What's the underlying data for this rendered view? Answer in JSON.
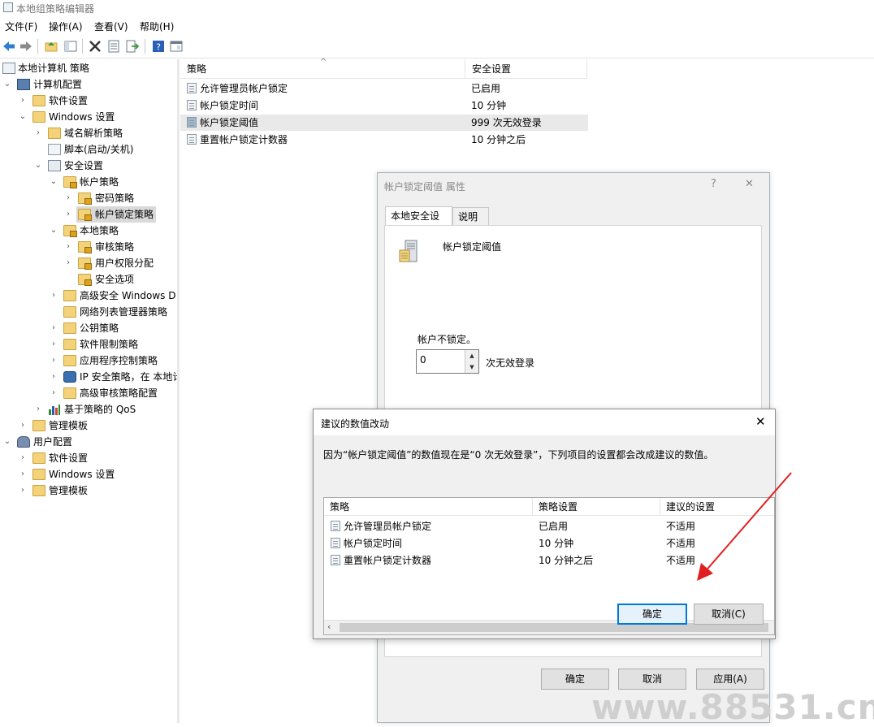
{
  "window": {
    "title": "本地组策略编辑器"
  },
  "menu": [
    "文件(F)",
    "操作(A)",
    "查看(V)",
    "帮助(H)"
  ],
  "toolbar": [
    "back-icon",
    "forward-icon",
    "up-folder-icon",
    "show-tree-icon",
    "delete-icon",
    "properties-icon",
    "export-icon",
    "help-icon",
    "console-icon"
  ],
  "tree": [
    {
      "label": "本地计算机 策略",
      "icon": "computer-policy-icon"
    },
    {
      "label": "计算机配置",
      "icon": "computer-icon"
    },
    {
      "label": "软件设置"
    },
    {
      "label": "Windows 设置"
    },
    {
      "label": "域名解析策略"
    },
    {
      "label": "脚本(启动/关机)"
    },
    {
      "label": "安全设置"
    },
    {
      "label": "帐户策略"
    },
    {
      "label": "密码策略"
    },
    {
      "label": "帐户锁定策略"
    },
    {
      "label": "本地策略"
    },
    {
      "label": "审核策略"
    },
    {
      "label": "用户权限分配"
    },
    {
      "label": "安全选项"
    },
    {
      "label": "高级安全 Windows D"
    },
    {
      "label": "网络列表管理器策略"
    },
    {
      "label": "公钥策略"
    },
    {
      "label": "软件限制策略"
    },
    {
      "label": "应用程序控制策略"
    },
    {
      "label": "IP 安全策略，在 本地计"
    },
    {
      "label": "高级审核策略配置"
    },
    {
      "label": "基于策略的 QoS"
    },
    {
      "label": "管理模板"
    },
    {
      "label": "用户配置"
    },
    {
      "label": "软件设置"
    },
    {
      "label": "Windows 设置"
    },
    {
      "label": "管理模板"
    }
  ],
  "list": {
    "headers": [
      "策略",
      "安全设置"
    ],
    "rows": [
      {
        "policy": "允许管理员帐户锁定",
        "setting": "已启用"
      },
      {
        "policy": "帐户锁定时间",
        "setting": "10 分钟"
      },
      {
        "policy": "帐户锁定阈值",
        "setting": "999 次无效登录"
      },
      {
        "policy": "重置帐户锁定计数器",
        "setting": "10 分钟之后"
      }
    ]
  },
  "props": {
    "title": "帐户锁定阈值 属性",
    "help": "?",
    "close": "✕",
    "tabs": [
      "本地安全设置",
      "说明"
    ],
    "policy_name": "帐户锁定阈值",
    "field_label": "帐户不锁定。",
    "value": "0",
    "unit": "次无效登录",
    "ok": "确定",
    "cancel": "取消",
    "apply": "应用(A)"
  },
  "suggest": {
    "title": "建议的数值改动",
    "close": "✕",
    "message": "因为“帐户锁定阈值”的数值现在是“0 次无效登录”，下列项目的设置都会改成建议的数值。",
    "headers": [
      "策略",
      "策略设置",
      "建议的设置"
    ],
    "rows": [
      {
        "policy": "允许管理员帐户锁定",
        "current": "已启用",
        "suggested": "不适用"
      },
      {
        "policy": "帐户锁定时间",
        "current": "10 分钟",
        "suggested": "不适用"
      },
      {
        "policy": "重置帐户锁定计数器",
        "current": "10 分钟之后",
        "suggested": "不适用"
      }
    ],
    "ok": "确定",
    "cancel": "取消(C)"
  },
  "watermark": "www.88531.cn",
  "colors": {
    "accent": "#0078d7",
    "arrow": "#e02020"
  }
}
